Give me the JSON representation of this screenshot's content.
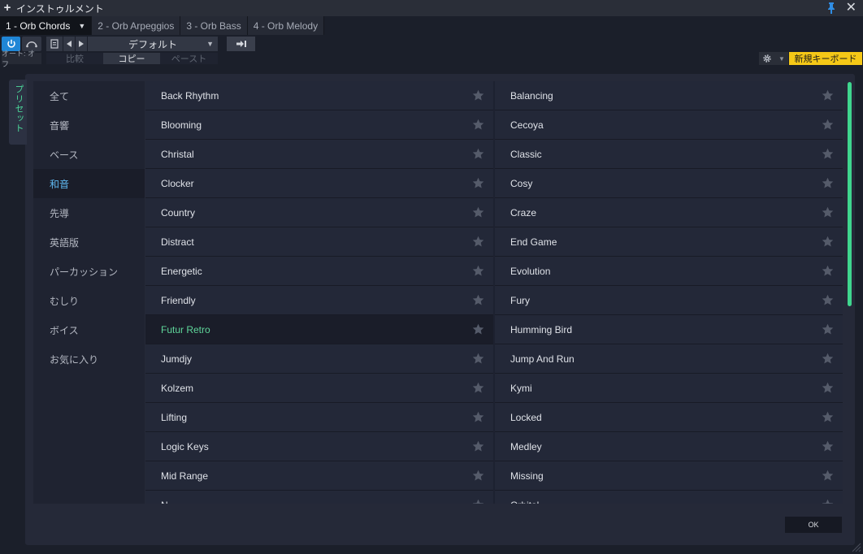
{
  "window": {
    "title": "インストゥルメント"
  },
  "tabs": [
    {
      "label": "1 - Orb Chords",
      "active": true
    },
    {
      "label": "2 - Orb Arpeggios",
      "active": false
    },
    {
      "label": "3 - Orb Bass",
      "active": false
    },
    {
      "label": "4 - Orb Melody",
      "active": false
    }
  ],
  "toolbar": {
    "auto_label": "オート: オフ",
    "preset_name": "デフォルト",
    "compare_label": "比較",
    "copy_label": "コピー",
    "paste_label": "ペースト",
    "new_keyboard_label": "新規キーボード",
    "accent_color": "#f5c817",
    "power_color": "#1f86d6"
  },
  "browser": {
    "side_tab_label": "プリセット",
    "categories": [
      {
        "label": "全て",
        "active": false
      },
      {
        "label": "音響",
        "active": false
      },
      {
        "label": "ベース",
        "active": false
      },
      {
        "label": "和音",
        "active": true
      },
      {
        "label": "先導",
        "active": false
      },
      {
        "label": "英語版",
        "active": false
      },
      {
        "label": "パーカッション",
        "active": false
      },
      {
        "label": "むしり",
        "active": false
      },
      {
        "label": "ボイス",
        "active": false
      },
      {
        "label": "お気に入り",
        "active": false
      }
    ],
    "presets_left": [
      {
        "name": "Back Rhythm"
      },
      {
        "name": "Blooming"
      },
      {
        "name": "Christal"
      },
      {
        "name": "Clocker"
      },
      {
        "name": "Country"
      },
      {
        "name": "Distract"
      },
      {
        "name": "Energetic"
      },
      {
        "name": "Friendly"
      },
      {
        "name": "Futur Retro",
        "active": true
      },
      {
        "name": "Jumdjy"
      },
      {
        "name": "Kolzem"
      },
      {
        "name": "Lifting"
      },
      {
        "name": "Logic Keys"
      },
      {
        "name": "Mid Range"
      },
      {
        "name": "N..."
      }
    ],
    "presets_right": [
      {
        "name": "Balancing"
      },
      {
        "name": "Cecoya"
      },
      {
        "name": "Classic"
      },
      {
        "name": "Cosy"
      },
      {
        "name": "Craze"
      },
      {
        "name": "End Game"
      },
      {
        "name": "Evolution"
      },
      {
        "name": "Fury"
      },
      {
        "name": "Humming Bird"
      },
      {
        "name": "Jump And Run"
      },
      {
        "name": "Kymi"
      },
      {
        "name": "Locked"
      },
      {
        "name": "Medley"
      },
      {
        "name": "Missing"
      },
      {
        "name": "Orbital..."
      }
    ],
    "ok_label": "OK",
    "highlight_color": "#5fd69a",
    "category_active_color": "#5fb8f0"
  }
}
